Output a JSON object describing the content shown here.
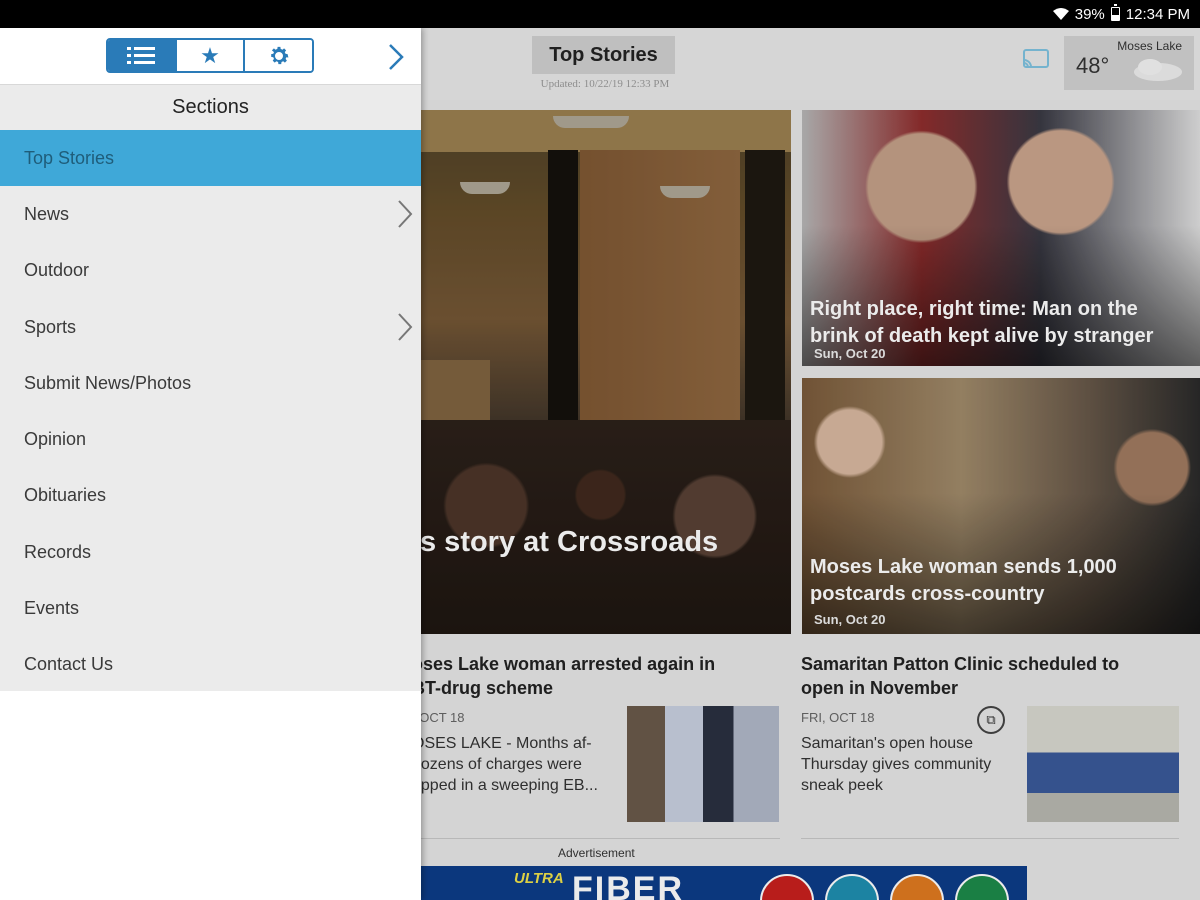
{
  "status_bar": {
    "battery": "39%",
    "time": "12:34 PM"
  },
  "header": {
    "title": "Top Stories",
    "updated": "Updated: 10/22/19 12:33 PM",
    "weather": {
      "city": "Moses Lake",
      "temp": "48°"
    }
  },
  "drawer": {
    "tabs": [
      {
        "name": "list",
        "icon": "list-icon",
        "active": true
      },
      {
        "name": "favorites",
        "icon": "star-icon",
        "active": false
      },
      {
        "name": "settings",
        "icon": "gear-icon",
        "active": false
      }
    ],
    "sections_title": "Sections",
    "items": [
      {
        "label": "Top Stories",
        "active": true,
        "has_sub": false
      },
      {
        "label": "News",
        "active": false,
        "has_sub": true
      },
      {
        "label": "Outdoor",
        "active": false,
        "has_sub": false
      },
      {
        "label": "Sports",
        "active": false,
        "has_sub": true
      },
      {
        "label": "Submit News/Photos",
        "active": false,
        "has_sub": false
      },
      {
        "label": "Opinion",
        "active": false,
        "has_sub": false
      },
      {
        "label": "Obituaries",
        "active": false,
        "has_sub": false
      },
      {
        "label": "Records",
        "active": false,
        "has_sub": false
      },
      {
        "label": "Events",
        "active": false,
        "has_sub": false
      },
      {
        "label": "Contact Us",
        "active": false,
        "has_sub": false
      }
    ]
  },
  "hero": {
    "caption": "s story at Crossroads"
  },
  "cards": [
    {
      "title": "Right place, right time: Man on the brink of death kept alive by stranger",
      "date": "Sun, Oct 20"
    },
    {
      "title": "Moses Lake woman sends 1,000 postcards cross-country",
      "date": "Sun, Oct 20"
    }
  ],
  "stories": [
    {
      "title": "oses Lake woman arrested again in\nBT-drug scheme",
      "date": ", OCT 18",
      "text": "OSES LAKE - Months af-\n dozens of charges were\nopped in a sweeping EB..."
    },
    {
      "title": "Samaritan Patton Clinic scheduled to open in November",
      "date": "FRI, OCT 18",
      "text": "Samaritan's open house Thursday gives community sneak peek"
    }
  ],
  "ad": {
    "label": "Advertisement",
    "tagline": "ULTRA",
    "big": "FIBER"
  },
  "colors": {
    "accent": "#2a7bb8",
    "active_item": "#3fa8d8"
  }
}
